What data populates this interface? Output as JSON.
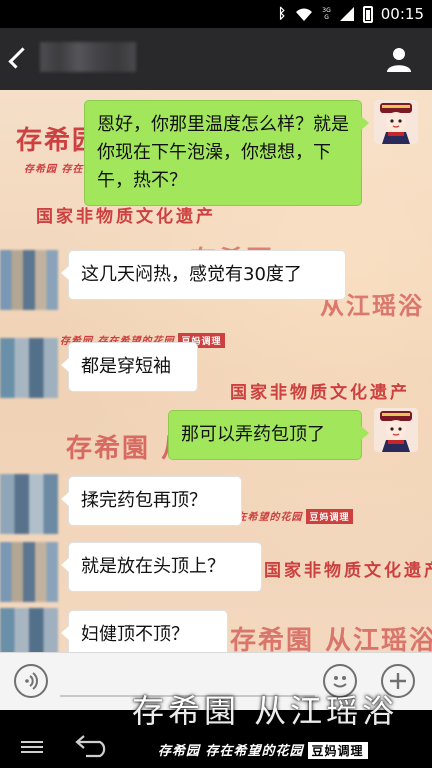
{
  "status_bar": {
    "time": "00:15",
    "network_badge_top": "3G",
    "network_badge_bottom": "G"
  },
  "header": {
    "contact_name_blurred": ""
  },
  "watermarks": {
    "logo_cn": "存希园",
    "logo_full": "存希園 从江瑶浴",
    "place": "从江瑶浴",
    "subtitle": "存希园  存在希望的花园",
    "brand_box": "豆妈调理",
    "heritage": "国家非物质文化遗产"
  },
  "messages": [
    {
      "side": "right",
      "text": "恩好，你那里温度怎么样？就是你现在下午泡澡，你想想，下午，热不？"
    },
    {
      "side": "left",
      "text": "这几天闷热，感觉有30度了"
    },
    {
      "side": "left",
      "text": "都是穿短袖"
    },
    {
      "side": "right",
      "text": "那可以弄药包顶了"
    },
    {
      "side": "left",
      "text": "揉完药包再顶？"
    },
    {
      "side": "left",
      "text": "就是放在头顶上？"
    },
    {
      "side": "left",
      "text": "妇健顶不顶？"
    }
  ],
  "input": {
    "value": "",
    "placeholder": ""
  },
  "footer": {
    "logo": "存希園 从江瑶浴",
    "subtitle": "存希园 存在希望的花园",
    "brand_box": "豆妈调理"
  },
  "colors": {
    "sent_bubble": "#a2e65b",
    "received_bubble": "#ffffff",
    "header_bg": "#29292b",
    "watermark_red": "#c6262a"
  }
}
